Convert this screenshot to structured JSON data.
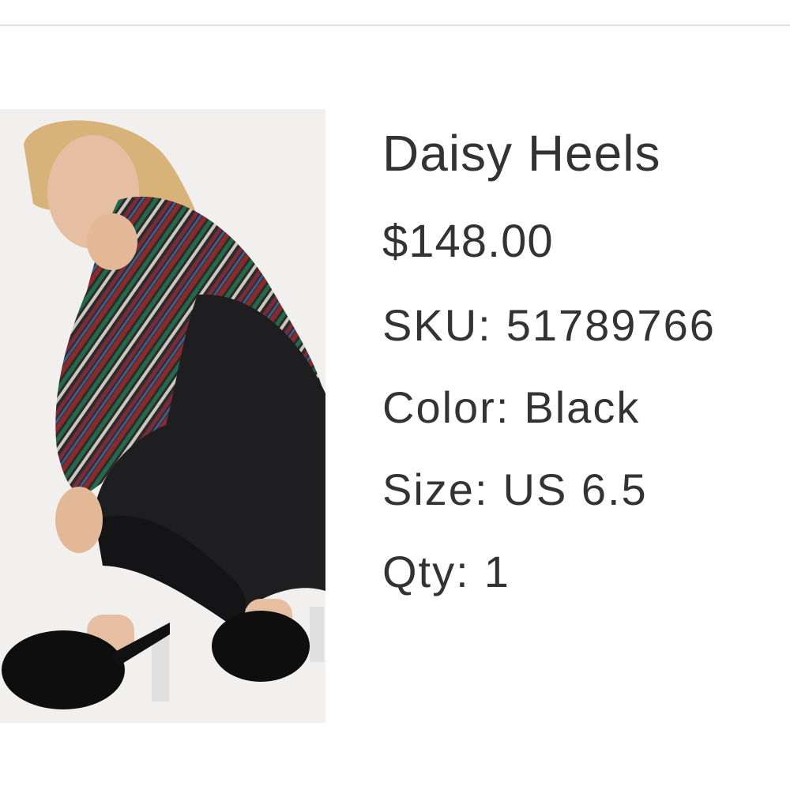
{
  "product": {
    "title": "Daisy Heels",
    "price": "$148.00",
    "sku_label": "SKU:",
    "sku_value": "51789766",
    "color_label": "Color:",
    "color_value": "Black",
    "size_label": "Size:",
    "size_value": "US 6.5",
    "qty_label": "Qty:",
    "qty_value": "1"
  },
  "colors": {
    "text": "#333333",
    "divider": "#e3e3e3",
    "photo_background": "#f1f0ee"
  }
}
